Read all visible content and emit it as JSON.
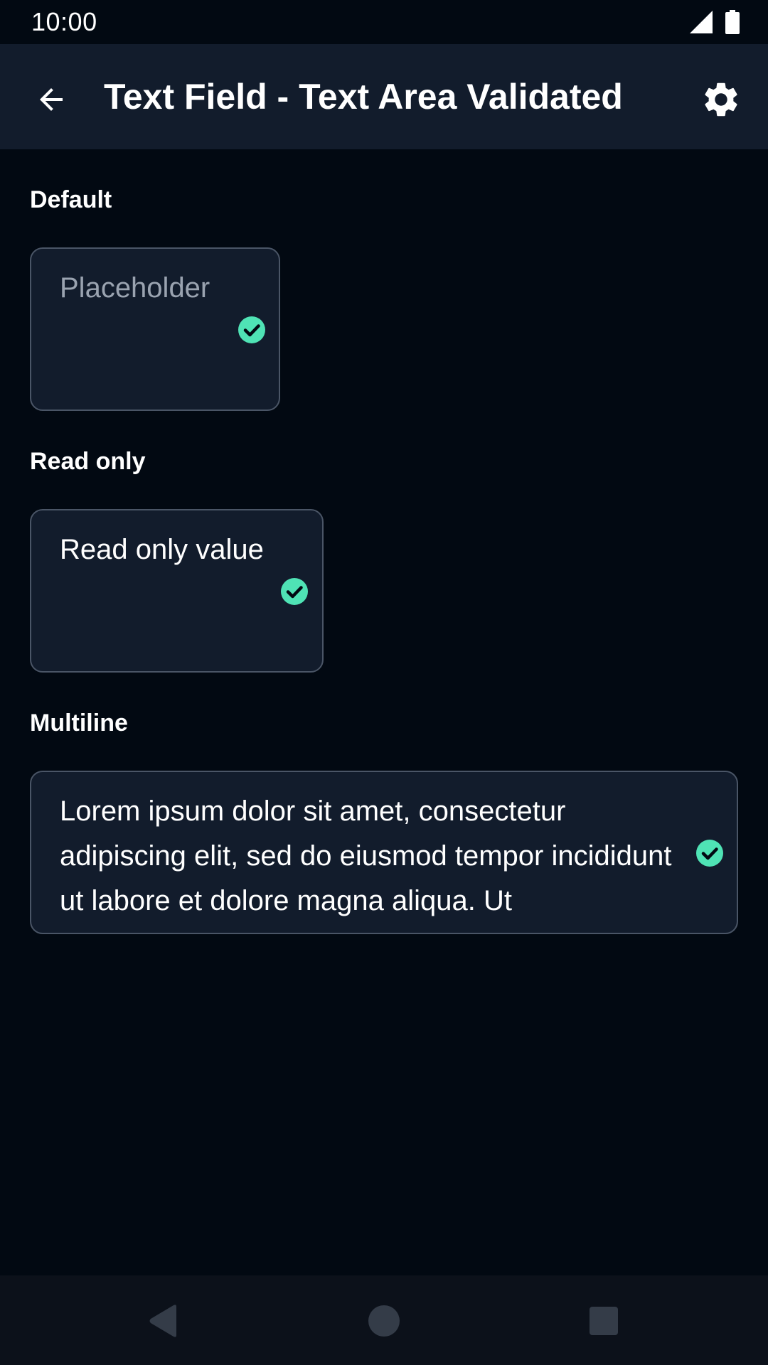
{
  "status_bar": {
    "time": "10:00",
    "icons": [
      "signal-icon",
      "battery-icon"
    ]
  },
  "app_bar": {
    "title": "Text Field - Text Area Validated",
    "back_icon": "arrow-back-icon",
    "settings_icon": "gear-icon"
  },
  "sections": {
    "default": {
      "label": "Default",
      "placeholder": "Placeholder",
      "value": ""
    },
    "read_only": {
      "label": "Read only",
      "value": "Read only value"
    },
    "multiline": {
      "label": "Multiline",
      "value": "Lorem ipsum dolor sit amet, consectetur adipiscing elit, sed do eiusmod tempor incididunt ut labore et dolore magna aliqua. Ut"
    }
  },
  "validation_icon": "check-circle-icon",
  "nav_bar": {
    "icons": [
      "back-triangle-icon",
      "home-circle-icon",
      "recents-square-icon"
    ]
  },
  "colors": {
    "background": "#020912",
    "surface": "#121c2c",
    "border": "#4a5566",
    "success": "#4fe3b5",
    "placeholder": "#9aa3b0",
    "nav_background": "#0c111a",
    "nav_icon": "#343c48"
  }
}
